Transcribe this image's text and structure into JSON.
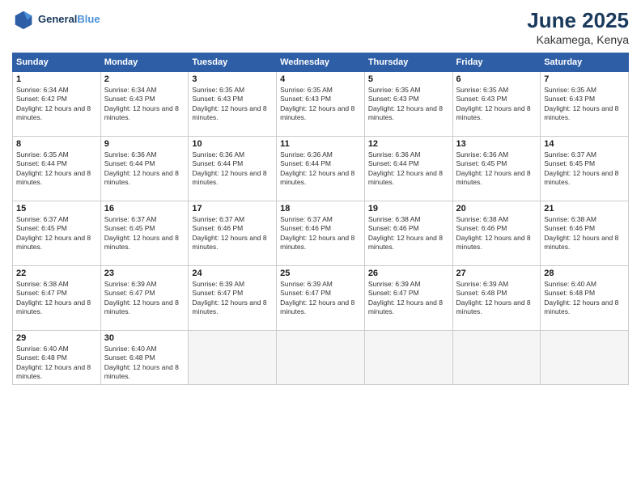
{
  "header": {
    "logo_line1": "General",
    "logo_line2": "Blue",
    "month_year": "June 2025",
    "location": "Kakamega, Kenya"
  },
  "calendar": {
    "days_of_week": [
      "Sunday",
      "Monday",
      "Tuesday",
      "Wednesday",
      "Thursday",
      "Friday",
      "Saturday"
    ],
    "weeks": [
      [
        null,
        {
          "day": 2,
          "sunrise": "6:34 AM",
          "sunset": "6:43 PM",
          "daylight": "12 hours and 8 minutes."
        },
        {
          "day": 3,
          "sunrise": "6:35 AM",
          "sunset": "6:43 PM",
          "daylight": "12 hours and 8 minutes."
        },
        {
          "day": 4,
          "sunrise": "6:35 AM",
          "sunset": "6:43 PM",
          "daylight": "12 hours and 8 minutes."
        },
        {
          "day": 5,
          "sunrise": "6:35 AM",
          "sunset": "6:43 PM",
          "daylight": "12 hours and 8 minutes."
        },
        {
          "day": 6,
          "sunrise": "6:35 AM",
          "sunset": "6:43 PM",
          "daylight": "12 hours and 8 minutes."
        },
        {
          "day": 7,
          "sunrise": "6:35 AM",
          "sunset": "6:43 PM",
          "daylight": "12 hours and 8 minutes."
        }
      ],
      [
        {
          "day": 1,
          "sunrise": "6:34 AM",
          "sunset": "6:42 PM",
          "daylight": "12 hours and 8 minutes."
        },
        {
          "day": 8,
          "sunrise": "6:35 AM",
          "sunset": "6:44 PM",
          "daylight": "12 hours and 8 minutes."
        },
        {
          "day": 9,
          "sunrise": "6:36 AM",
          "sunset": "6:44 PM",
          "daylight": "12 hours and 8 minutes."
        },
        {
          "day": 10,
          "sunrise": "6:36 AM",
          "sunset": "6:44 PM",
          "daylight": "12 hours and 8 minutes."
        },
        {
          "day": 11,
          "sunrise": "6:36 AM",
          "sunset": "6:44 PM",
          "daylight": "12 hours and 8 minutes."
        },
        {
          "day": 12,
          "sunrise": "6:36 AM",
          "sunset": "6:44 PM",
          "daylight": "12 hours and 8 minutes."
        },
        {
          "day": 13,
          "sunrise": "6:36 AM",
          "sunset": "6:45 PM",
          "daylight": "12 hours and 8 minutes."
        },
        {
          "day": 14,
          "sunrise": "6:37 AM",
          "sunset": "6:45 PM",
          "daylight": "12 hours and 8 minutes."
        }
      ],
      [
        {
          "day": 15,
          "sunrise": "6:37 AM",
          "sunset": "6:45 PM",
          "daylight": "12 hours and 8 minutes."
        },
        {
          "day": 16,
          "sunrise": "6:37 AM",
          "sunset": "6:45 PM",
          "daylight": "12 hours and 8 minutes."
        },
        {
          "day": 17,
          "sunrise": "6:37 AM",
          "sunset": "6:46 PM",
          "daylight": "12 hours and 8 minutes."
        },
        {
          "day": 18,
          "sunrise": "6:37 AM",
          "sunset": "6:46 PM",
          "daylight": "12 hours and 8 minutes."
        },
        {
          "day": 19,
          "sunrise": "6:38 AM",
          "sunset": "6:46 PM",
          "daylight": "12 hours and 8 minutes."
        },
        {
          "day": 20,
          "sunrise": "6:38 AM",
          "sunset": "6:46 PM",
          "daylight": "12 hours and 8 minutes."
        },
        {
          "day": 21,
          "sunrise": "6:38 AM",
          "sunset": "6:46 PM",
          "daylight": "12 hours and 8 minutes."
        }
      ],
      [
        {
          "day": 22,
          "sunrise": "6:38 AM",
          "sunset": "6:47 PM",
          "daylight": "12 hours and 8 minutes."
        },
        {
          "day": 23,
          "sunrise": "6:39 AM",
          "sunset": "6:47 PM",
          "daylight": "12 hours and 8 minutes."
        },
        {
          "day": 24,
          "sunrise": "6:39 AM",
          "sunset": "6:47 PM",
          "daylight": "12 hours and 8 minutes."
        },
        {
          "day": 25,
          "sunrise": "6:39 AM",
          "sunset": "6:47 PM",
          "daylight": "12 hours and 8 minutes."
        },
        {
          "day": 26,
          "sunrise": "6:39 AM",
          "sunset": "6:47 PM",
          "daylight": "12 hours and 8 minutes."
        },
        {
          "day": 27,
          "sunrise": "6:39 AM",
          "sunset": "6:48 PM",
          "daylight": "12 hours and 8 minutes."
        },
        {
          "day": 28,
          "sunrise": "6:40 AM",
          "sunset": "6:48 PM",
          "daylight": "12 hours and 8 minutes."
        }
      ],
      [
        {
          "day": 29,
          "sunrise": "6:40 AM",
          "sunset": "6:48 PM",
          "daylight": "12 hours and 8 minutes."
        },
        {
          "day": 30,
          "sunrise": "6:40 AM",
          "sunset": "6:48 PM",
          "daylight": "12 hours and 8 minutes."
        },
        null,
        null,
        null,
        null,
        null
      ]
    ],
    "row1": [
      {
        "day": 1,
        "sunrise": "6:34 AM",
        "sunset": "6:42 PM",
        "daylight": "12 hours and 8 minutes."
      },
      {
        "day": 2,
        "sunrise": "6:34 AM",
        "sunset": "6:43 PM",
        "daylight": "12 hours and 8 minutes."
      },
      {
        "day": 3,
        "sunrise": "6:35 AM",
        "sunset": "6:43 PM",
        "daylight": "12 hours and 8 minutes."
      },
      {
        "day": 4,
        "sunrise": "6:35 AM",
        "sunset": "6:43 PM",
        "daylight": "12 hours and 8 minutes."
      },
      {
        "day": 5,
        "sunrise": "6:35 AM",
        "sunset": "6:43 PM",
        "daylight": "12 hours and 8 minutes."
      },
      {
        "day": 6,
        "sunrise": "6:35 AM",
        "sunset": "6:43 PM",
        "daylight": "12 hours and 8 minutes."
      },
      {
        "day": 7,
        "sunrise": "6:35 AM",
        "sunset": "6:43 PM",
        "daylight": "12 hours and 8 minutes."
      }
    ]
  }
}
